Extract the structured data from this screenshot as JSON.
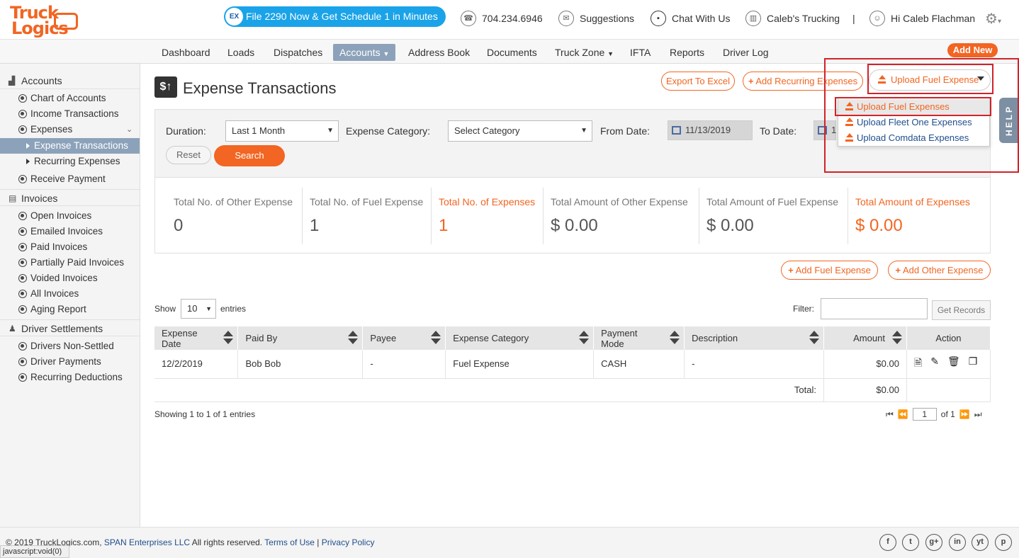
{
  "header": {
    "logo_line1": "Truck",
    "logo_line2": "Logics",
    "promo_badge": "EX",
    "promo_text": "File 2290 Now & Get Schedule 1 in Minutes",
    "phone": "704.234.6946",
    "suggestions": "Suggestions",
    "chat": "Chat With Us",
    "company": "Caleb's Trucking",
    "separator": "|",
    "greeting": "Hi Caleb Flachman"
  },
  "nav": {
    "items": [
      "Dashboard",
      "Loads",
      "Dispatches",
      "Accounts",
      "Address Book",
      "Documents",
      "Truck Zone",
      "IFTA",
      "Reports",
      "Driver Log"
    ],
    "add_new": "Add New"
  },
  "sidebar": {
    "accounts": "Accounts",
    "chart_of_accounts": "Chart of Accounts",
    "income_transactions": "Income Transactions",
    "expenses": "Expenses",
    "expense_transactions": "Expense Transactions",
    "recurring_expenses": "Recurring Expenses",
    "receive_payment": "Receive Payment",
    "invoices": "Invoices",
    "open_invoices": "Open Invoices",
    "emailed_invoices": "Emailed Invoices",
    "paid_invoices": "Paid Invoices",
    "partially_paid_invoices": "Partially Paid Invoices",
    "voided_invoices": "Voided Invoices",
    "all_invoices": "All Invoices",
    "aging_report": "Aging Report",
    "driver_settlements": "Driver Settlements",
    "drivers_non_settled": "Drivers Non-Settled",
    "driver_payments": "Driver Payments",
    "recurring_deductions": "Recurring Deductions"
  },
  "page": {
    "title": "Expense Transactions",
    "title_icon": "$↑",
    "export_excel": "Export To Excel",
    "add_recurring": "Add Recurring Expenses",
    "upload_fuel": "Upload Fuel Expense"
  },
  "dropdown": {
    "items": [
      "Upload Fuel Expenses",
      "Upload Fleet One Expenses",
      "Upload Comdata Expenses"
    ]
  },
  "help": "HELP",
  "filters": {
    "duration_label": "Duration:",
    "duration_value": "Last 1 Month",
    "category_label": "Expense Category:",
    "category_value": "Select Category",
    "from_label": "From Date:",
    "from_value": "11/13/2019",
    "to_label": "To Date:",
    "to_value": "1",
    "reset": "Reset",
    "search": "Search"
  },
  "stats": [
    {
      "label": "Total No. of Other Expense",
      "value": "0"
    },
    {
      "label": "Total No. of Fuel Expense",
      "value": "1"
    },
    {
      "label": "Total No. of Expenses",
      "value": "1"
    },
    {
      "label": "Total Amount of Other Expense",
      "value": "$ 0.00"
    },
    {
      "label": "Total Amount of Fuel Expense",
      "value": "$ 0.00"
    },
    {
      "label": "Total Amount of Expenses",
      "value": "$ 0.00"
    }
  ],
  "actions": {
    "add_fuel": "Add Fuel Expense",
    "add_other": "Add Other Expense"
  },
  "table_controls": {
    "show": "Show",
    "entries_value": "10",
    "entries": "entries",
    "filter": "Filter:",
    "get_records": "Get Records"
  },
  "table": {
    "headers": [
      "Expense Date",
      "Paid By",
      "Payee",
      "Expense Category",
      "Payment Mode",
      "Description",
      "Amount",
      "Action"
    ],
    "rows": [
      {
        "date": "12/2/2019",
        "paid_by": "Bob Bob",
        "payee": "-",
        "category": "Fuel Expense",
        "mode": "CASH",
        "description": "-",
        "amount": "$0.00"
      }
    ],
    "total_label": "Total:",
    "total_value": "$0.00"
  },
  "pagination": {
    "showing": "Showing 1 to 1 of 1 entries",
    "page": "1",
    "of": "of 1"
  },
  "footer": {
    "copyright": "© 2019 TruckLogics.com,",
    "company_link": "SPAN Enterprises LLC",
    "rights": "All rights reserved.",
    "terms": "Terms of Use",
    "sep": "|",
    "privacy": "Privacy Policy",
    "status_bar": "javascript:void(0)"
  },
  "social": [
    "f",
    "t",
    "g+",
    "in",
    "yt",
    "p"
  ],
  "colors": {
    "accent": "#f26522",
    "nav_active": "#8ca2ba",
    "promo": "#1aa3e8",
    "highlight_box": "#d0232a"
  }
}
